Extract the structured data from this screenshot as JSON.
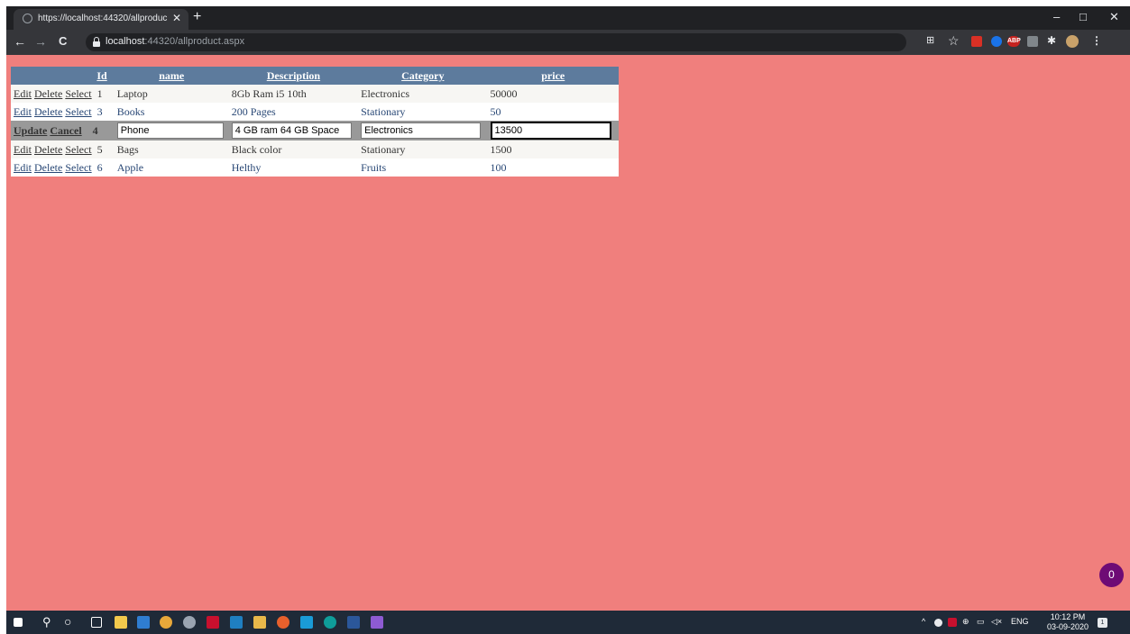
{
  "browser": {
    "tab_title": "https://localhost:44320/allproduc",
    "tab_close": "✕",
    "new_tab": "+",
    "url_host": "localhost",
    "url_rest": ":44320/allproduct.aspx",
    "minimize": "–",
    "maximize": "□",
    "close": "✕",
    "back": "←",
    "forward": "→",
    "reload": "C",
    "star": "☆",
    "menu": "⋮",
    "ext_abp": "ABP"
  },
  "grid": {
    "headers": [
      "Id",
      "name",
      "Description",
      "Category",
      "price"
    ],
    "action_labels": {
      "edit": "Edit",
      "delete": "Delete",
      "select": "Select",
      "update": "Update",
      "cancel": "Cancel"
    },
    "rows": [
      {
        "id": "1",
        "name": "Laptop",
        "description": "8Gb Ram i5 10th",
        "category": "Electronics",
        "price": "50000"
      },
      {
        "id": "3",
        "name": "Books",
        "description": "200 Pages",
        "category": "Stationary",
        "price": "50"
      },
      {
        "id": "4",
        "name": "Phone",
        "description": "4 GB ram 64 GB Space",
        "category": "Electronics",
        "price": "13500"
      },
      {
        "id": "5",
        "name": "Bags",
        "description": "Black color",
        "category": "Stationary",
        "price": "1500"
      },
      {
        "id": "6",
        "name": "Apple",
        "description": "Helthy",
        "category": "Fruits",
        "price": "100"
      }
    ]
  },
  "badge": "0",
  "taskbar": {
    "lang": "ENG",
    "time": "10:12 PM",
    "date": "03-09-2020",
    "notif_count": "1",
    "tray_caret": "^"
  },
  "colors": {
    "page_bg": "#f07f7d",
    "grid_header": "#5d7b9d",
    "edit_row": "#999999",
    "badge": "#6e0b75"
  }
}
